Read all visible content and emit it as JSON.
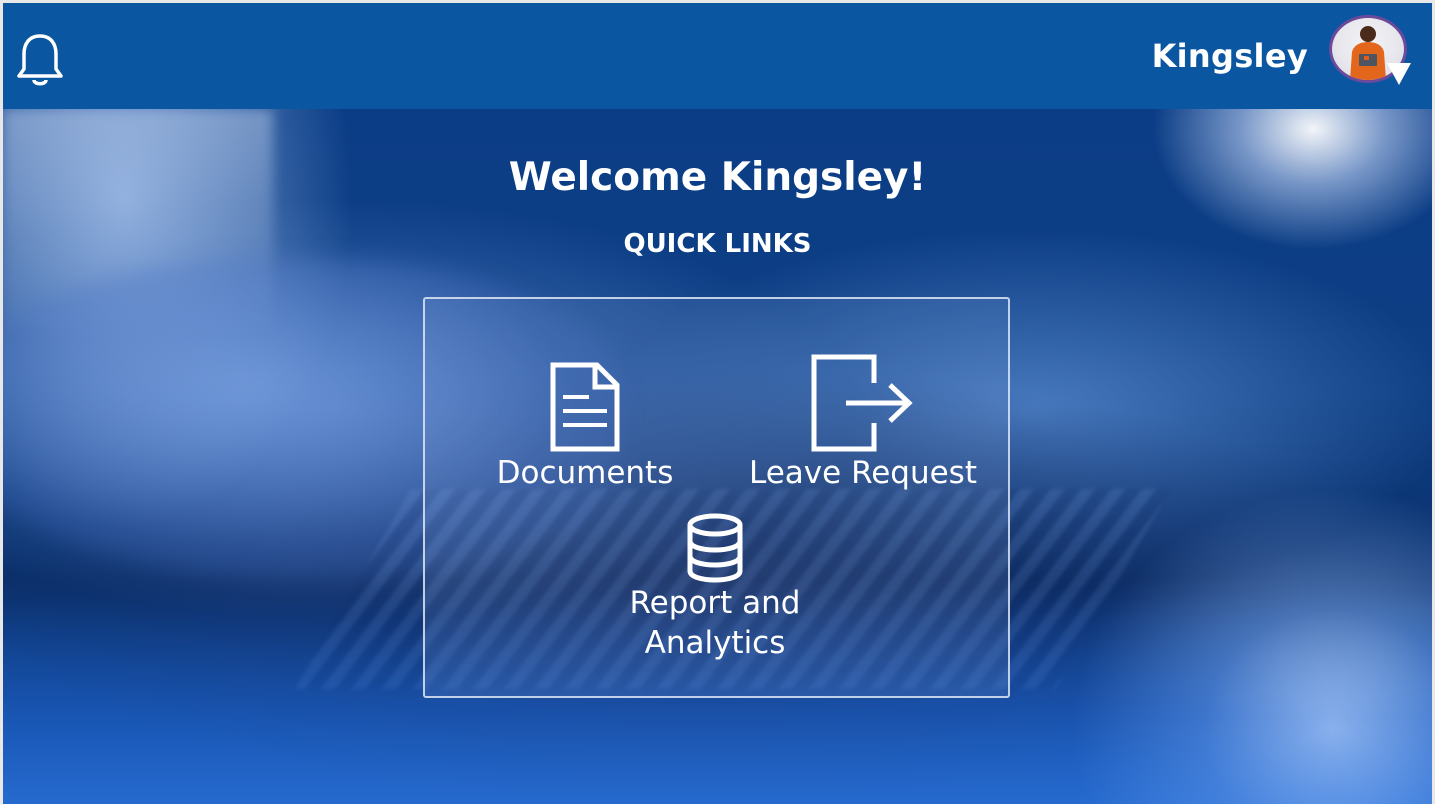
{
  "header": {
    "user_name": "Kingsley",
    "notification_icon": "bell-icon",
    "avatar_icon": "user-avatar",
    "avatar_dropdown_icon": "caret-down-icon",
    "background_color": "#0b56a0"
  },
  "main": {
    "welcome_text": "Welcome Kingsley!",
    "quick_links_title": "QUICK LINKS",
    "links": [
      {
        "label": "Documents",
        "icon": "document-icon"
      },
      {
        "label": "Leave Request",
        "icon": "exit-arrow-icon"
      },
      {
        "label_line1": "Report and",
        "label_line2": "Analytics",
        "icon": "database-icon"
      }
    ]
  },
  "colors": {
    "accent": "#0b56a0",
    "text": "#ffffff"
  }
}
